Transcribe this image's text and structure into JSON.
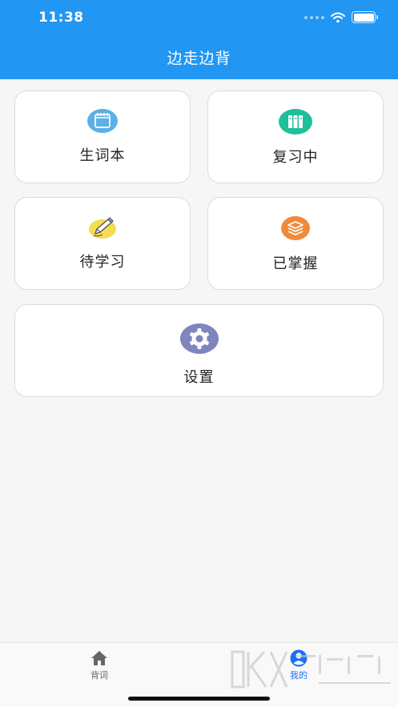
{
  "status_bar": {
    "time": "11:38"
  },
  "header": {
    "title": "边走边背"
  },
  "cards": {
    "vocab_book": {
      "label": "生词本",
      "icon": "notebook-icon",
      "color": "#5bb0e6"
    },
    "reviewing": {
      "label": "复习中",
      "icon": "books-icon",
      "color": "#1fbf9a"
    },
    "to_learn": {
      "label": "待学习",
      "icon": "pencil-icon",
      "color": "#f4dc55"
    },
    "mastered": {
      "label": "已掌握",
      "icon": "layers-icon",
      "color": "#f08a3a"
    },
    "settings": {
      "label": "设置",
      "icon": "gear-icon",
      "color": "#7e85bf"
    }
  },
  "tabbar": {
    "words": {
      "label": "背词",
      "icon": "home-icon"
    },
    "mine": {
      "label": "我的",
      "icon": "user-icon",
      "active": true
    }
  },
  "colors": {
    "primary": "#2196f3",
    "active_tab": "#1e6ff5",
    "inactive_tab": "#666666"
  }
}
